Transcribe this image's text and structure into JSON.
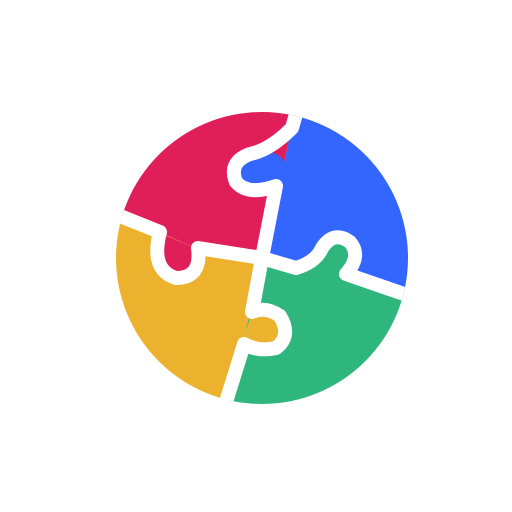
{
  "logo": {
    "name": "puzzle-circle-logo",
    "background": "#ffffff",
    "pieces": [
      {
        "name": "top-left-puzzle-piece",
        "color": "#e01e5a"
      },
      {
        "name": "top-right-puzzle-piece",
        "color": "#3366ff"
      },
      {
        "name": "bottom-right-puzzle-piece",
        "color": "#2eb67d"
      },
      {
        "name": "bottom-left-puzzle-piece",
        "color": "#ecb22e"
      }
    ]
  }
}
